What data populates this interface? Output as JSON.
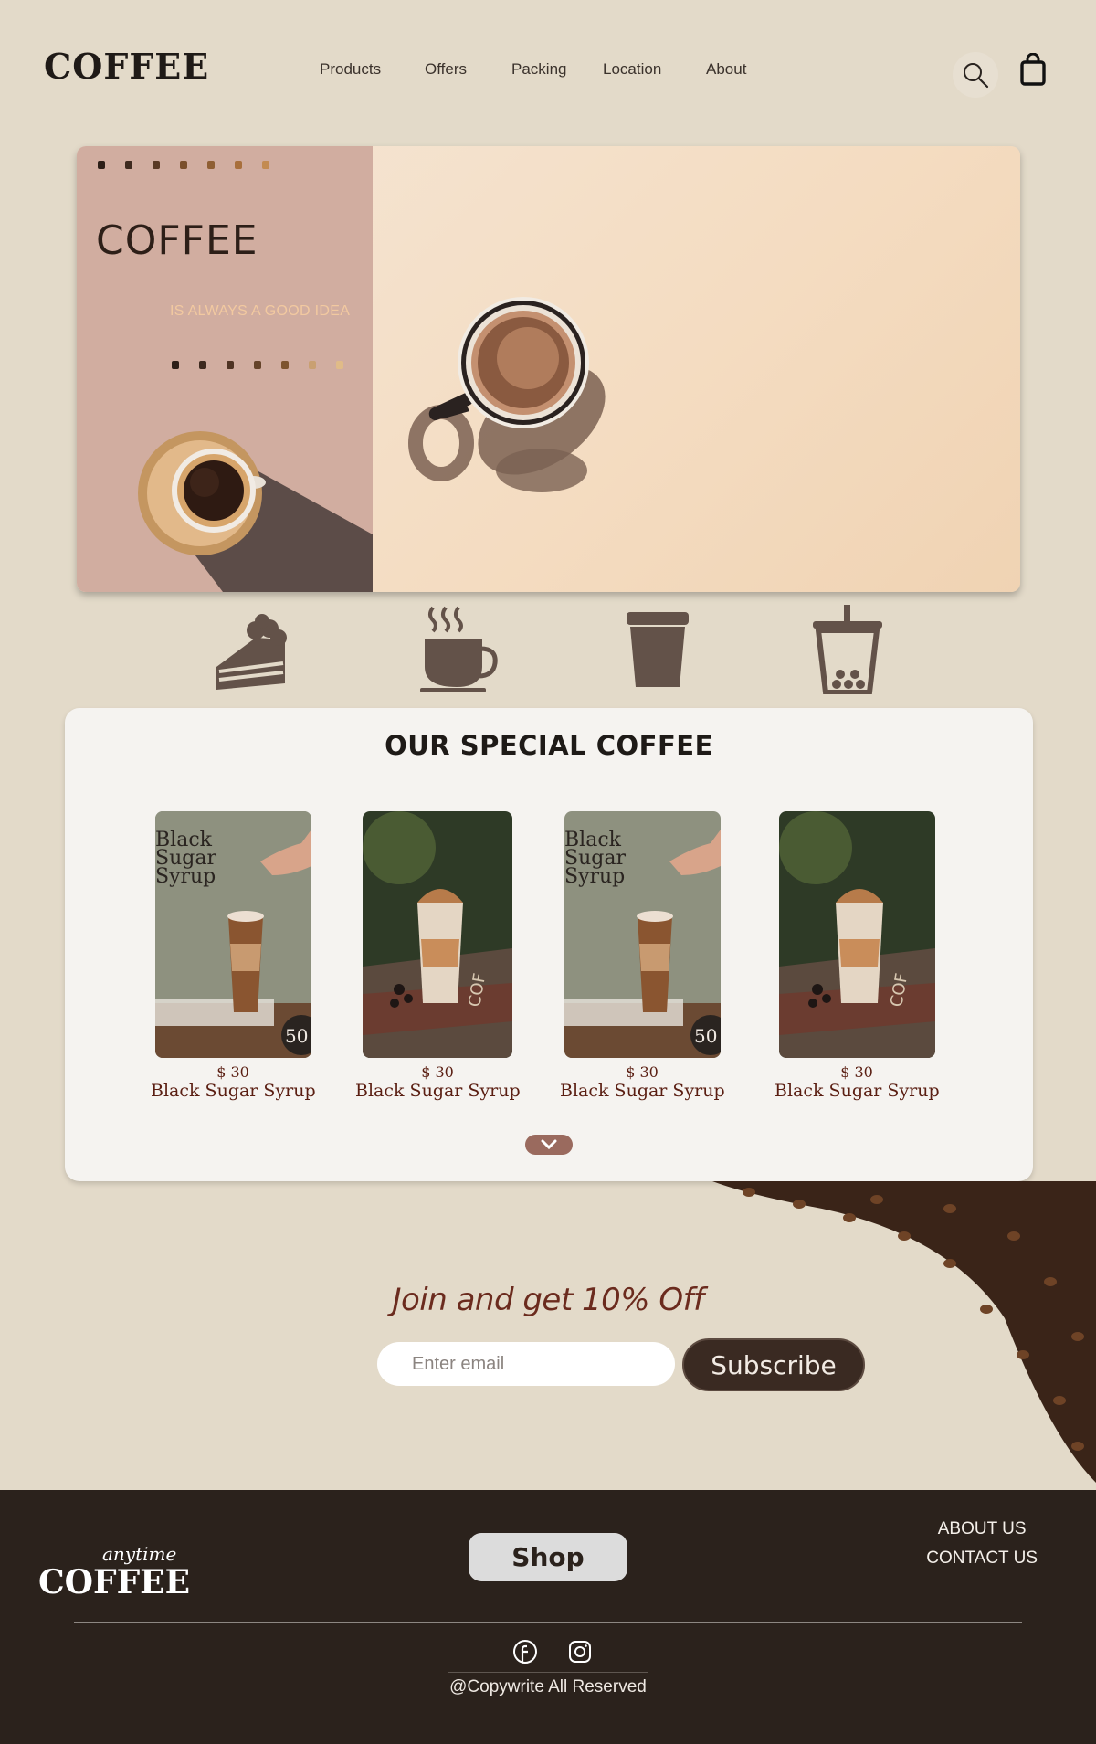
{
  "nav": {
    "logo": "COFFEE",
    "links": [
      "Products",
      "Offers",
      "Packing",
      "Location",
      "About"
    ],
    "search_icon": "search-icon",
    "cart_icon": "shopping-bag-icon"
  },
  "hero": {
    "title": "COFFEE",
    "subtitle": "IS ALWAYS A GOOD IDEA"
  },
  "categories": [
    {
      "icon": "cake-slice-icon"
    },
    {
      "icon": "hot-coffee-cup-icon"
    },
    {
      "icon": "takeaway-cup-icon"
    },
    {
      "icon": "bubble-tea-icon"
    }
  ],
  "special": {
    "title": "OUR SPECIAL COFFEE",
    "products": [
      {
        "price": "$ 30",
        "name": "Black Sugar Syrup",
        "poster_text": "Black Sugar Syrup",
        "badge": "50"
      },
      {
        "price": "$ 30",
        "name": "Black Sugar Syrup",
        "book_text": "COF"
      },
      {
        "price": "$ 30",
        "name": "Black Sugar Syrup",
        "poster_text": "Black Sugar Syrup",
        "badge": "50"
      },
      {
        "price": "$ 30",
        "name": "Black Sugar Syrup",
        "book_text": "COF"
      }
    ],
    "more_icon": "chevron-down-icon"
  },
  "newsletter": {
    "headline": "Join and get 10% Off",
    "email_placeholder": "Enter email",
    "subscribe_label": "Subscribe"
  },
  "footer": {
    "logo_tagline": "anytime",
    "logo_word": "COFFEE",
    "shop_label": "Shop",
    "links": [
      "ABOUT US",
      "CONTACT US"
    ],
    "social": [
      "facebook-icon",
      "instagram-icon"
    ],
    "copyright": "@Copywrite All Reserved"
  },
  "colors": {
    "page_bg": "#e3dac9",
    "hero_panel": "#d1ada0",
    "accent_brown": "#5a1e12",
    "footer_bg": "#2b221c",
    "button_dark": "#3a2a22"
  }
}
